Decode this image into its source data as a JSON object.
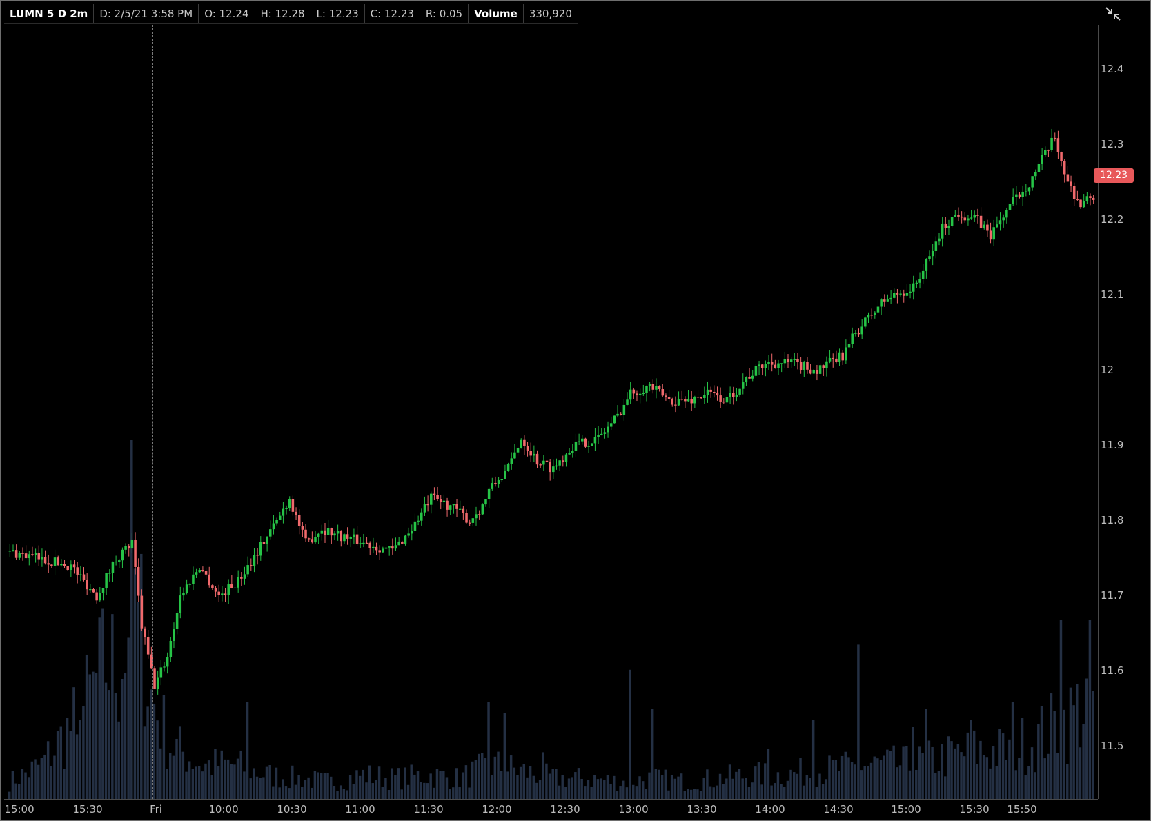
{
  "infobar": {
    "symbol": "LUMN 5 D 2m",
    "date": "D: 2/5/21 3:58 PM",
    "open": "O: 12.24",
    "high": "H: 12.28",
    "low": "L: 12.23",
    "close": "C: 12.23",
    "range": "R: 0.05",
    "volume_label": "Volume",
    "volume_value": "330,920"
  },
  "price_badge": "12.23",
  "colors": {
    "up": "#26c447",
    "down": "#f0696c",
    "volume": "#243044",
    "background": "#000000",
    "grid_text": "#bcbcbc"
  },
  "icons": {
    "corner": "collapse-expand-icon"
  },
  "chart_data": {
    "type": "candlestick",
    "title": "",
    "ylim": [
      11.43,
      12.46
    ],
    "yticks": [
      "12.4",
      "12.3",
      "12.2",
      "12.1",
      "12",
      "11.9",
      "11.8",
      "11.7",
      "11.6",
      "11.5"
    ],
    "xticks": [
      "15:00",
      "15:30",
      "Fri",
      "10:00",
      "10:30",
      "11:00",
      "11:30",
      "12:00",
      "12:30",
      "13:00",
      "13:30",
      "14:00",
      "14:30",
      "15:00",
      "15:30",
      "15:50"
    ],
    "price_anchors": [
      [
        0,
        11.76
      ],
      [
        10,
        11.75
      ],
      [
        20,
        11.74
      ],
      [
        28,
        11.7
      ],
      [
        34,
        11.75
      ],
      [
        39,
        11.77
      ],
      [
        42,
        11.66
      ],
      [
        46,
        11.58
      ],
      [
        50,
        11.62
      ],
      [
        54,
        11.7
      ],
      [
        60,
        11.74
      ],
      [
        66,
        11.7
      ],
      [
        72,
        11.72
      ],
      [
        78,
        11.76
      ],
      [
        84,
        11.8
      ],
      [
        88,
        11.83
      ],
      [
        93,
        11.77
      ],
      [
        98,
        11.79
      ],
      [
        104,
        11.78
      ],
      [
        112,
        11.77
      ],
      [
        120,
        11.76
      ],
      [
        126,
        11.79
      ],
      [
        132,
        11.83
      ],
      [
        138,
        11.82
      ],
      [
        144,
        11.8
      ],
      [
        148,
        11.82
      ],
      [
        150,
        11.84
      ],
      [
        156,
        11.87
      ],
      [
        160,
        11.91
      ],
      [
        165,
        11.88
      ],
      [
        170,
        11.87
      ],
      [
        176,
        11.9
      ],
      [
        184,
        11.91
      ],
      [
        190,
        11.94
      ],
      [
        194,
        11.97
      ],
      [
        200,
        11.98
      ],
      [
        206,
        11.96
      ],
      [
        212,
        11.96
      ],
      [
        218,
        11.97
      ],
      [
        224,
        11.96
      ],
      [
        230,
        11.99
      ],
      [
        236,
        12.01
      ],
      [
        244,
        12.01
      ],
      [
        252,
        12.0
      ],
      [
        260,
        12.02
      ],
      [
        264,
        12.05
      ],
      [
        272,
        12.09
      ],
      [
        276,
        12.1
      ],
      [
        282,
        12.11
      ],
      [
        287,
        12.15
      ],
      [
        291,
        12.19
      ],
      [
        296,
        12.21
      ],
      [
        302,
        12.2
      ],
      [
        306,
        12.18
      ],
      [
        312,
        12.22
      ],
      [
        318,
        12.25
      ],
      [
        322,
        12.28
      ],
      [
        326,
        12.31
      ],
      [
        330,
        12.25
      ],
      [
        334,
        12.22
      ],
      [
        337,
        12.23
      ]
    ],
    "volume_anchors": [
      [
        0,
        0.05
      ],
      [
        10,
        0.1
      ],
      [
        20,
        0.22
      ],
      [
        25,
        0.3
      ],
      [
        30,
        0.4
      ],
      [
        34,
        0.38
      ],
      [
        38,
        0.7
      ],
      [
        44,
        0.3
      ],
      [
        50,
        0.16
      ],
      [
        60,
        0.1
      ],
      [
        70,
        0.1
      ],
      [
        80,
        0.07
      ],
      [
        90,
        0.06
      ],
      [
        100,
        0.05
      ],
      [
        110,
        0.07
      ],
      [
        120,
        0.06
      ],
      [
        130,
        0.07
      ],
      [
        140,
        0.06
      ],
      [
        150,
        0.1
      ],
      [
        160,
        0.08
      ],
      [
        170,
        0.06
      ],
      [
        180,
        0.06
      ],
      [
        190,
        0.05
      ],
      [
        200,
        0.06
      ],
      [
        210,
        0.05
      ],
      [
        220,
        0.06
      ],
      [
        230,
        0.07
      ],
      [
        240,
        0.07
      ],
      [
        250,
        0.08
      ],
      [
        260,
        0.09
      ],
      [
        270,
        0.1
      ],
      [
        280,
        0.1
      ],
      [
        290,
        0.12
      ],
      [
        300,
        0.14
      ],
      [
        310,
        0.14
      ],
      [
        320,
        0.18
      ],
      [
        330,
        0.24
      ],
      [
        337,
        0.3
      ]
    ],
    "volume_spikes": [
      [
        21,
        0.18
      ],
      [
        22,
        0.22
      ],
      [
        36,
        0.35
      ],
      [
        40,
        0.55
      ],
      [
        74,
        0.27
      ],
      [
        149,
        0.27
      ],
      [
        154,
        0.24
      ],
      [
        166,
        0.13
      ],
      [
        193,
        0.36
      ],
      [
        200,
        0.25
      ],
      [
        236,
        0.14
      ],
      [
        250,
        0.22
      ],
      [
        264,
        0.43
      ],
      [
        281,
        0.2
      ],
      [
        285,
        0.25
      ],
      [
        299,
        0.22
      ],
      [
        312,
        0.27
      ],
      [
        327,
        0.5
      ],
      [
        332,
        0.32
      ],
      [
        336,
        0.5
      ]
    ],
    "vol_scale_max": 1.0
  }
}
